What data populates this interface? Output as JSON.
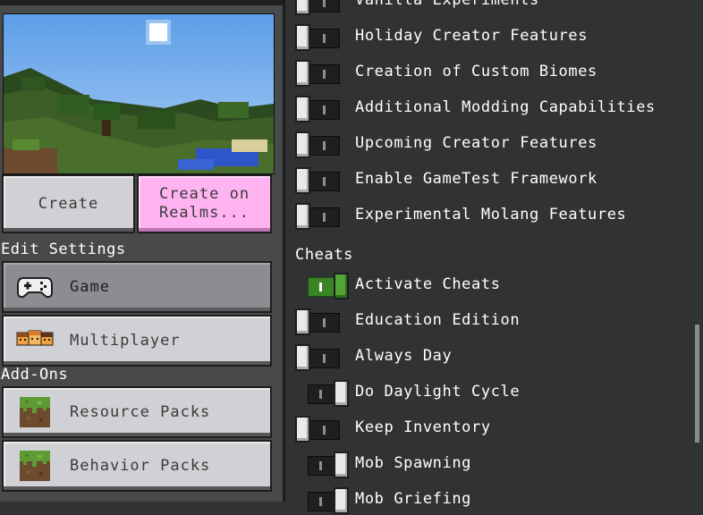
{
  "left_panel": {
    "create_label": "Create",
    "create_realms_label": "Create on Realms...",
    "edit_settings_label": "Edit Settings",
    "addons_label": "Add-Ons",
    "nav": [
      {
        "label": "Game",
        "icon": "gamepad-icon",
        "selected": true
      },
      {
        "label": "Multiplayer",
        "icon": "players-icon",
        "selected": false
      }
    ],
    "addons": [
      {
        "label": "Resource Packs",
        "icon": "grass-block-icon"
      },
      {
        "label": "Behavior Packs",
        "icon": "grass-block-icon"
      }
    ]
  },
  "experiments": [
    {
      "label": "Vanilla Experiments",
      "state": "off"
    },
    {
      "label": "Holiday Creator Features",
      "state": "off"
    },
    {
      "label": "Creation of Custom Biomes",
      "state": "off"
    },
    {
      "label": "Additional Modding Capabilities",
      "state": "off"
    },
    {
      "label": "Upcoming Creator Features",
      "state": "off"
    },
    {
      "label": "Enable GameTest Framework",
      "state": "off"
    },
    {
      "label": "Experimental Molang Features",
      "state": "off"
    }
  ],
  "cheats": {
    "heading": "Cheats",
    "items": [
      {
        "label": "Activate Cheats",
        "state": "on"
      },
      {
        "label": "Education Edition",
        "state": "off"
      },
      {
        "label": "Always Day",
        "state": "off"
      },
      {
        "label": "Do Daylight Cycle",
        "state": "on"
      },
      {
        "label": "Keep Inventory",
        "state": "off"
      },
      {
        "label": "Mob Spawning",
        "state": "on"
      },
      {
        "label": "Mob Griefing",
        "state": "on"
      }
    ]
  },
  "colors": {
    "panel_bg": "#313233",
    "left_bg": "#48494a",
    "realms_pink": "#ffb3f0",
    "toggle_green": "#3c8527"
  }
}
